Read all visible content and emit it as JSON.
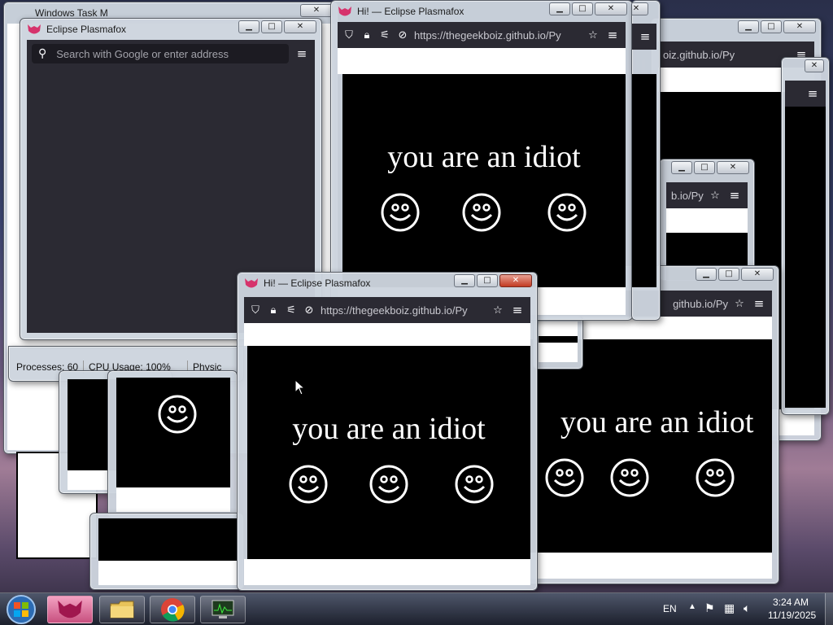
{
  "popup_windows": {
    "title": "Hi! — Eclipse Plasmafox",
    "url": "https://thegeekboiz.github.io/Py",
    "message": "you are an idiot",
    "url_fragment_1": "oiz.github.io/Py",
    "url_fragment_2": "b.io/Py",
    "url_fragment_3": "github.io/Py"
  },
  "browser_window": {
    "title": "Eclipse Plasmafox",
    "search_placeholder": "Search with Google or enter address"
  },
  "task_manager": {
    "title": "Windows Task M",
    "processes": "Processes: 60",
    "cpu": "CPU Usage: 100%",
    "physical": "Physic"
  },
  "taskbar": {
    "language": "EN",
    "time": "3:24 AM",
    "date": "11/19/2025"
  },
  "colors": {
    "browser_toolbar": "#2b2a33",
    "browser_content": "#2b2a33",
    "accent_logo": "#d6336c",
    "popup_bg": "#000000"
  }
}
